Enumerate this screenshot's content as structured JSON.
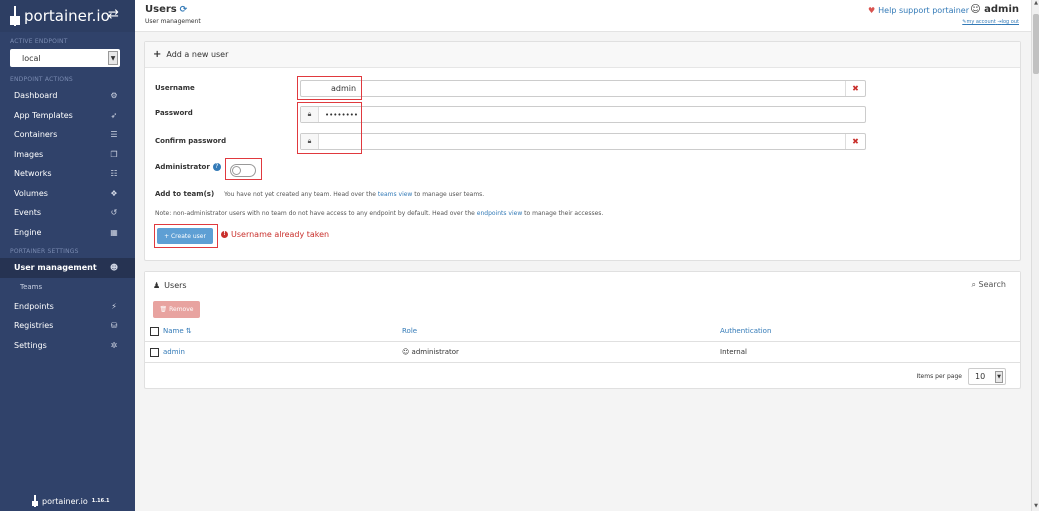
{
  "sidebar": {
    "brand": "portainer.io",
    "toggle_icon": "exchange-icon",
    "active_endpoint_title": "ACTIVE ENDPOINT",
    "endpoint_value": "local",
    "endpoint_actions_title": "ENDPOINT ACTIONS",
    "endpoint_items": [
      {
        "label": "Dashboard",
        "icon": "tachometer-icon",
        "glyph": "⚙"
      },
      {
        "label": "App Templates",
        "icon": "rocket-icon",
        "glyph": "➶"
      },
      {
        "label": "Containers",
        "icon": "list-icon",
        "glyph": "☰"
      },
      {
        "label": "Images",
        "icon": "clone-icon",
        "glyph": "❐"
      },
      {
        "label": "Networks",
        "icon": "sitemap-icon",
        "glyph": "☷"
      },
      {
        "label": "Volumes",
        "icon": "cubes-icon",
        "glyph": "❖"
      },
      {
        "label": "Events",
        "icon": "history-icon",
        "glyph": "↺"
      },
      {
        "label": "Engine",
        "icon": "th-icon",
        "glyph": "▦"
      }
    ],
    "settings_title": "PORTAINER SETTINGS",
    "settings_items": [
      {
        "label": "User management",
        "icon": "users-icon",
        "glyph": "☻"
      },
      {
        "label": "Teams",
        "icon": "",
        "glyph": ""
      },
      {
        "label": "Endpoints",
        "icon": "plug-icon",
        "glyph": "⚡"
      },
      {
        "label": "Registries",
        "icon": "database-icon",
        "glyph": "⛁"
      },
      {
        "label": "Settings",
        "icon": "cogs-icon",
        "glyph": "✲"
      }
    ],
    "footer_brand": "portainer.io",
    "footer_version": "1.16.1"
  },
  "header": {
    "title": "Users",
    "breadcrumb": "User management",
    "help_text": "Help support portainer",
    "username": "admin",
    "my_account": "my account",
    "log_out": "log out"
  },
  "add_user": {
    "panel_title": "Add a new user",
    "username_label": "Username",
    "username_value": "admin",
    "password_label": "Password",
    "password_value": "••••••••",
    "confirm_label": "Confirm password",
    "confirm_value": "",
    "admin_label": "Administrator",
    "admin_enabled": false,
    "teams_label": "Add to team(s)",
    "teams_note_pre": "You have not yet created any team. Head over the",
    "teams_note_link": "teams view",
    "teams_note_post": "to manage user teams.",
    "access_note_pre": "Note: non-administrator users with no team do not have access to any endpoint by default. Head over the",
    "access_note_link": "endpoints view",
    "access_note_post": "to manage their accesses.",
    "create_button": "+ Create user",
    "error_text": "Username already taken"
  },
  "users_table": {
    "panel_title": "Users",
    "search_label": "Search",
    "remove_button": "Remove",
    "columns": [
      "Name",
      "Role",
      "Authentication"
    ],
    "rows": [
      {
        "name": "admin",
        "role": "administrator",
        "auth": "Internal"
      }
    ],
    "items_per_page_label": "Items per page",
    "items_per_page_value": "10"
  },
  "colors": {
    "sidebar_bg": "#30426a",
    "link": "#337ab7",
    "error": "#c9302c",
    "highlight": "#e0393e"
  }
}
